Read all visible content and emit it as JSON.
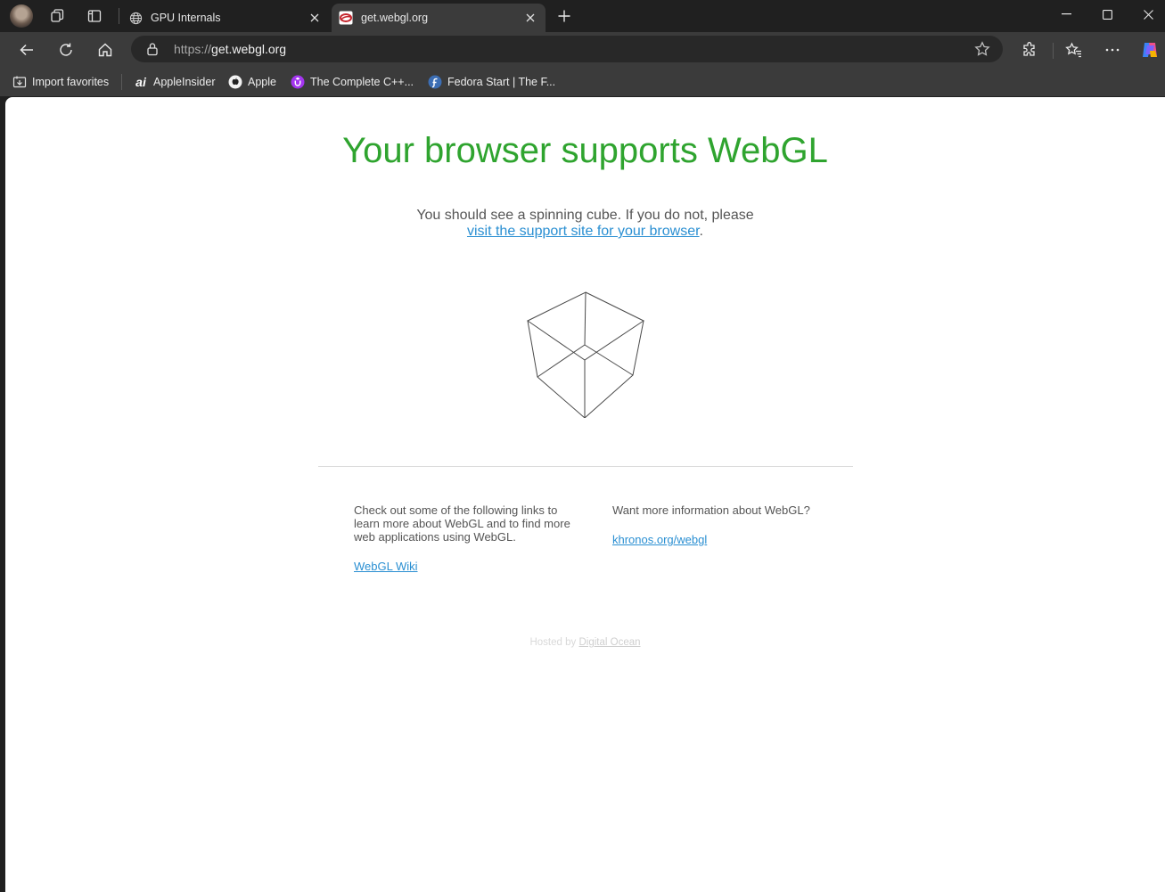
{
  "browser": {
    "tabs": [
      {
        "title": "GPU Internals",
        "active": false,
        "icon": "globe-icon"
      },
      {
        "title": "get.webgl.org",
        "active": true,
        "icon": "webgl-site-icon"
      }
    ],
    "address": {
      "scheme": "https://",
      "host": "get.webgl.org"
    },
    "bookmarks": [
      {
        "label": "Import favorites",
        "icon": "import-icon"
      },
      {
        "label": "AppleInsider",
        "icon": "appleinsider-icon"
      },
      {
        "label": "Apple",
        "icon": "apple-icon"
      },
      {
        "label": "The Complete C++...",
        "icon": "udemy-icon"
      },
      {
        "label": "Fedora Start | The F...",
        "icon": "fedora-icon"
      }
    ],
    "colors": {
      "frame": "#202020",
      "toolbar": "#3b3b3b",
      "accent_copilot": "#7b61ff"
    }
  },
  "page": {
    "title": "Your browser supports WebGL",
    "intro_text": "You should see a spinning cube. If you do not, please",
    "intro_link": "visit the support site for your browser",
    "intro_end": ".",
    "left_col_text": "Check out some of the following links to learn more about WebGL and to find more web applications using WebGL.",
    "left_col_link": "WebGL Wiki",
    "right_col_text": "Want more information about WebGL?",
    "right_col_link": "khronos.org/webgl",
    "hosted_prefix": "Hosted by ",
    "hosted_link": "Digital Ocean",
    "colors": {
      "title": "#2fa42f",
      "link": "#2a8fd2",
      "text": "#555555"
    }
  }
}
